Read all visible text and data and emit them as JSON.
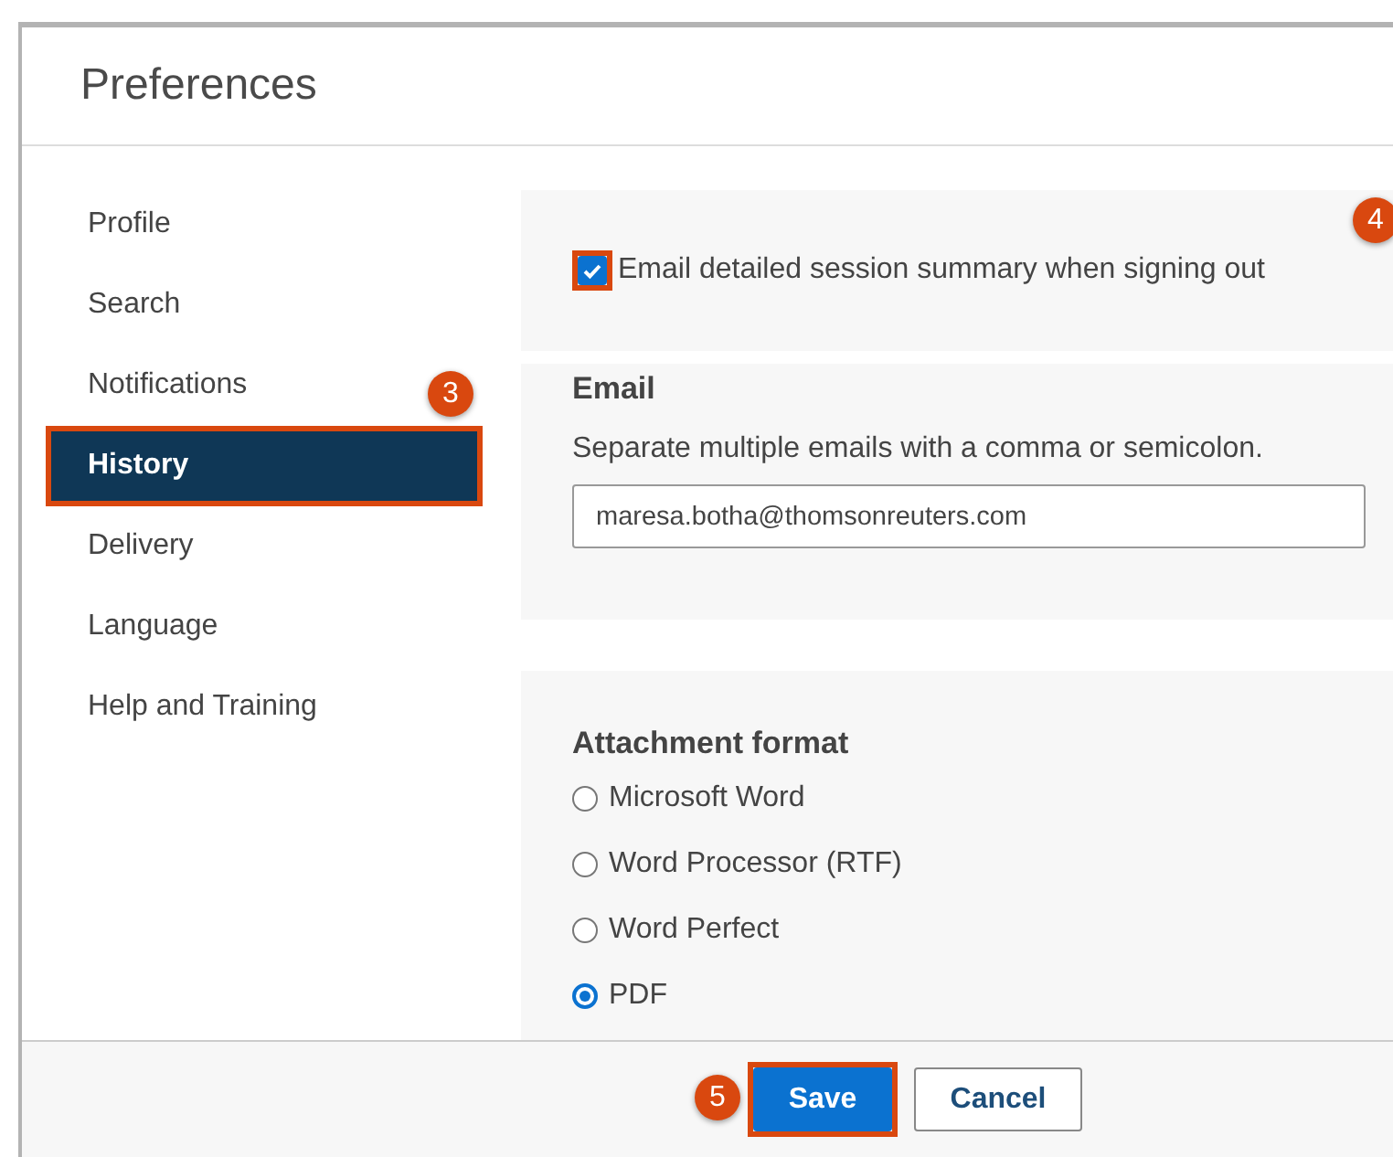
{
  "window": {
    "title": "Preferences"
  },
  "sidebar": {
    "items": [
      {
        "label": "Profile",
        "selected": false
      },
      {
        "label": "Search",
        "selected": false
      },
      {
        "label": "Notifications",
        "selected": false
      },
      {
        "label": "History",
        "selected": true,
        "highlighted": true,
        "callout": "3"
      },
      {
        "label": "Delivery",
        "selected": false
      },
      {
        "label": "Language",
        "selected": false
      },
      {
        "label": "Help and Training",
        "selected": false
      }
    ]
  },
  "session_summary": {
    "label": "Email detailed session summary when signing out",
    "checked": true,
    "highlighted": true,
    "callout": "4"
  },
  "email": {
    "heading": "Email",
    "hint": "Separate multiple emails with a comma or semicolon.",
    "value": "maresa.botha@thomsonreuters.com"
  },
  "attachment_format": {
    "heading": "Attachment format",
    "options": [
      {
        "label": "Microsoft Word",
        "selected": false
      },
      {
        "label": "Word Processor (RTF)",
        "selected": false
      },
      {
        "label": "Word Perfect",
        "selected": false
      },
      {
        "label": "PDF",
        "selected": true
      }
    ]
  },
  "buttons": [
    {
      "label": "Save",
      "kind": "primary",
      "highlighted": true,
      "callout": "5"
    },
    {
      "label": "Cancel",
      "kind": "secondary",
      "highlighted": false
    }
  ]
}
